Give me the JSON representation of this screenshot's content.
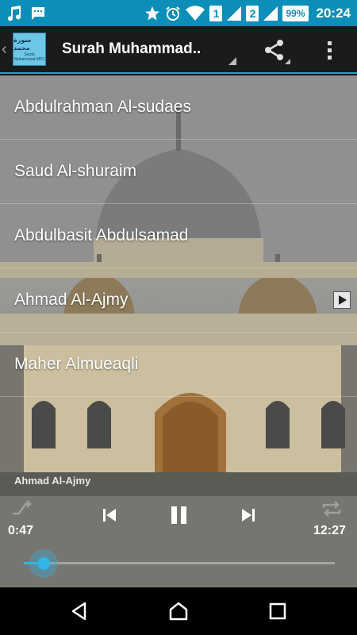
{
  "status_bar": {
    "icons": [
      "music-note-icon",
      "sms-icon",
      "star-icon",
      "alarm-icon",
      "wifi-icon",
      "sim1-signal-icon",
      "sim2-signal-icon",
      "battery-icon"
    ],
    "sim1_label": "1",
    "sim2_label": "2",
    "battery": "99%",
    "time": "20:24",
    "color": "#0b8fb8"
  },
  "action_bar": {
    "logo_arabic": "سورة محمد",
    "logo_text": "Surah Muhammad MP3",
    "title": "Surah Muhammad..",
    "share_icon": "share-icon",
    "overflow_icon": "overflow-menu-icon"
  },
  "reciters": [
    {
      "name": "Abdulrahman Al-sudaes"
    },
    {
      "name": "Saud Al-shuraim"
    },
    {
      "name": "Abdulbasit Abdulsamad"
    },
    {
      "name": "Ahmad Al-Ajmy",
      "playing": true
    },
    {
      "name": "Maher Almueaqli"
    }
  ],
  "player": {
    "now_playing": "Ahmad Al-Ajmy",
    "elapsed": "0:47",
    "total": "12:27",
    "progress": 0.063,
    "accent": "#33b5e5"
  },
  "nav_bar": {
    "icons": [
      "back-icon",
      "home-icon",
      "recents-icon"
    ]
  }
}
